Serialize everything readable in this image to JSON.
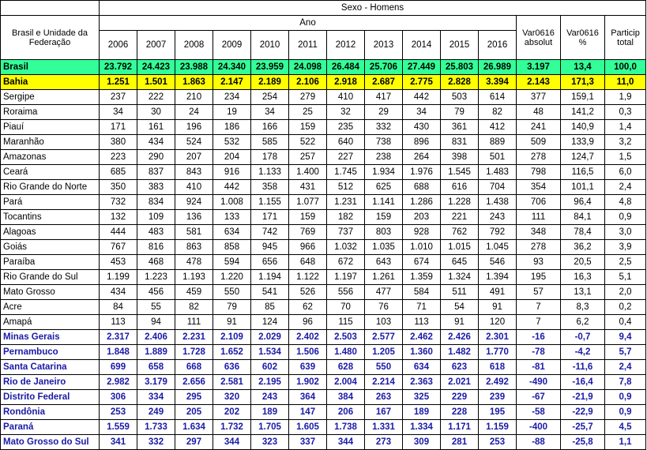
{
  "header": {
    "title": "Sexo - Homens",
    "region_col": "Brasil e Unidade da Federação",
    "year_group": "Ano",
    "years": [
      "2006",
      "2007",
      "2008",
      "2009",
      "2010",
      "2011",
      "2012",
      "2013",
      "2014",
      "2015",
      "2016"
    ],
    "var_abs": "Var0616 absolut",
    "var_pct": "Var0616 %",
    "particip": "Particip total"
  },
  "colors": {
    "brasil_row": "#33ff99",
    "bahia_row": "#ffff00",
    "negative_text": "#1a1aa6"
  },
  "rows": [
    {
      "name": "Brasil",
      "style": "brasil",
      "values": [
        "23.792",
        "24.423",
        "23.988",
        "24.340",
        "23.959",
        "24.098",
        "26.484",
        "25.706",
        "27.449",
        "25.803",
        "26.989",
        "3.197",
        "13,4",
        "100,0"
      ]
    },
    {
      "name": "Bahia",
      "style": "bahia",
      "values": [
        "1.251",
        "1.501",
        "1.863",
        "2.147",
        "2.189",
        "2.106",
        "2.918",
        "2.687",
        "2.775",
        "2.828",
        "3.394",
        "2.143",
        "171,3",
        "11,0"
      ]
    },
    {
      "name": "Sergipe",
      "style": "normal",
      "values": [
        "237",
        "222",
        "210",
        "234",
        "254",
        "279",
        "410",
        "417",
        "442",
        "503",
        "614",
        "377",
        "159,1",
        "1,9"
      ]
    },
    {
      "name": "Roraima",
      "style": "normal",
      "values": [
        "34",
        "30",
        "24",
        "19",
        "34",
        "25",
        "32",
        "29",
        "34",
        "79",
        "82",
        "48",
        "141,2",
        "0,3"
      ]
    },
    {
      "name": "Piauí",
      "style": "normal",
      "values": [
        "171",
        "161",
        "196",
        "186",
        "166",
        "159",
        "235",
        "332",
        "430",
        "361",
        "412",
        "241",
        "140,9",
        "1,4"
      ]
    },
    {
      "name": "Maranhão",
      "style": "normal",
      "values": [
        "380",
        "434",
        "524",
        "532",
        "585",
        "522",
        "640",
        "738",
        "896",
        "831",
        "889",
        "509",
        "133,9",
        "3,2"
      ]
    },
    {
      "name": "Amazonas",
      "style": "normal",
      "values": [
        "223",
        "290",
        "207",
        "204",
        "178",
        "257",
        "227",
        "238",
        "264",
        "398",
        "501",
        "278",
        "124,7",
        "1,5"
      ]
    },
    {
      "name": "Ceará",
      "style": "normal",
      "values": [
        "685",
        "837",
        "843",
        "916",
        "1.133",
        "1.400",
        "1.745",
        "1.934",
        "1.976",
        "1.545",
        "1.483",
        "798",
        "116,5",
        "6,0"
      ]
    },
    {
      "name": "Rio Grande do Norte",
      "style": "normal",
      "values": [
        "350",
        "383",
        "410",
        "442",
        "358",
        "431",
        "512",
        "625",
        "688",
        "616",
        "704",
        "354",
        "101,1",
        "2,4"
      ]
    },
    {
      "name": "Pará",
      "style": "normal",
      "values": [
        "732",
        "834",
        "924",
        "1.008",
        "1.155",
        "1.077",
        "1.231",
        "1.141",
        "1.286",
        "1.228",
        "1.438",
        "706",
        "96,4",
        "4,8"
      ]
    },
    {
      "name": "Tocantins",
      "style": "normal",
      "values": [
        "132",
        "109",
        "136",
        "133",
        "171",
        "159",
        "182",
        "159",
        "203",
        "221",
        "243",
        "111",
        "84,1",
        "0,9"
      ]
    },
    {
      "name": "Alagoas",
      "style": "normal",
      "values": [
        "444",
        "483",
        "581",
        "634",
        "742",
        "769",
        "737",
        "803",
        "928",
        "762",
        "792",
        "348",
        "78,4",
        "3,0"
      ]
    },
    {
      "name": "Goiás",
      "style": "normal",
      "values": [
        "767",
        "816",
        "863",
        "858",
        "945",
        "966",
        "1.032",
        "1.035",
        "1.010",
        "1.015",
        "1.045",
        "278",
        "36,2",
        "3,9"
      ]
    },
    {
      "name": "Paraíba",
      "style": "normal",
      "values": [
        "453",
        "468",
        "478",
        "594",
        "656",
        "648",
        "672",
        "643",
        "674",
        "645",
        "546",
        "93",
        "20,5",
        "2,5"
      ]
    },
    {
      "name": "Rio Grande do Sul",
      "style": "normal",
      "values": [
        "1.199",
        "1.223",
        "1.193",
        "1.220",
        "1.194",
        "1.122",
        "1.197",
        "1.261",
        "1.359",
        "1.324",
        "1.394",
        "195",
        "16,3",
        "5,1"
      ]
    },
    {
      "name": "Mato Grosso",
      "style": "normal",
      "values": [
        "434",
        "456",
        "459",
        "550",
        "541",
        "526",
        "556",
        "477",
        "584",
        "511",
        "491",
        "57",
        "13,1",
        "2,0"
      ]
    },
    {
      "name": "Acre",
      "style": "normal",
      "values": [
        "84",
        "55",
        "82",
        "79",
        "85",
        "62",
        "70",
        "76",
        "71",
        "54",
        "91",
        "7",
        "8,3",
        "0,2"
      ]
    },
    {
      "name": "Amapá",
      "style": "normal",
      "values": [
        "113",
        "94",
        "111",
        "91",
        "124",
        "96",
        "115",
        "103",
        "113",
        "91",
        "120",
        "7",
        "6,2",
        "0,4"
      ]
    },
    {
      "name": "Minas Gerais",
      "style": "neg",
      "values": [
        "2.317",
        "2.406",
        "2.231",
        "2.109",
        "2.029",
        "2.402",
        "2.503",
        "2.577",
        "2.462",
        "2.426",
        "2.301",
        "-16",
        "-0,7",
        "9,4"
      ]
    },
    {
      "name": "Pernambuco",
      "style": "neg",
      "values": [
        "1.848",
        "1.889",
        "1.728",
        "1.652",
        "1.534",
        "1.506",
        "1.480",
        "1.205",
        "1.360",
        "1.482",
        "1.770",
        "-78",
        "-4,2",
        "5,7"
      ]
    },
    {
      "name": "Santa Catarina",
      "style": "neg",
      "values": [
        "699",
        "658",
        "668",
        "636",
        "602",
        "639",
        "628",
        "550",
        "634",
        "623",
        "618",
        "-81",
        "-11,6",
        "2,4"
      ]
    },
    {
      "name": "Rio de Janeiro",
      "style": "neg",
      "values": [
        "2.982",
        "3.179",
        "2.656",
        "2.581",
        "2.195",
        "1.902",
        "2.004",
        "2.214",
        "2.363",
        "2.021",
        "2.492",
        "-490",
        "-16,4",
        "7,8"
      ]
    },
    {
      "name": "Distrito Federal",
      "style": "neg",
      "values": [
        "306",
        "334",
        "295",
        "320",
        "243",
        "364",
        "384",
        "263",
        "325",
        "229",
        "239",
        "-67",
        "-21,9",
        "0,9"
      ]
    },
    {
      "name": "Rondônia",
      "style": "neg",
      "values": [
        "253",
        "249",
        "205",
        "202",
        "189",
        "147",
        "206",
        "167",
        "189",
        "228",
        "195",
        "-58",
        "-22,9",
        "0,9"
      ]
    },
    {
      "name": "Paraná",
      "style": "neg",
      "values": [
        "1.559",
        "1.733",
        "1.634",
        "1.732",
        "1.705",
        "1.605",
        "1.738",
        "1.331",
        "1.334",
        "1.171",
        "1.159",
        "-400",
        "-25,7",
        "4,5"
      ]
    },
    {
      "name": "Mato Grosso do Sul",
      "style": "neg",
      "values": [
        "341",
        "332",
        "297",
        "344",
        "323",
        "337",
        "344",
        "273",
        "309",
        "281",
        "253",
        "-88",
        "-25,8",
        "1,1"
      ]
    }
  ]
}
